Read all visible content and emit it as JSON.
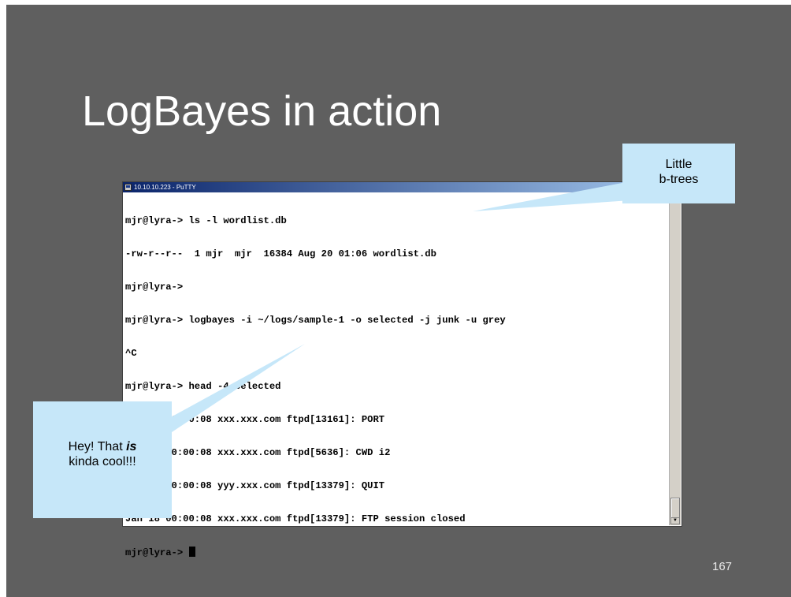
{
  "slide": {
    "title": "LogBayes in action",
    "page_number": "167"
  },
  "window": {
    "title": "10.10.10.223 - PuTTY",
    "icon": "putty-icon"
  },
  "terminal": {
    "lines": [
      "mjr@lyra-> ls -l wordlist.db",
      "-rw-r--r--  1 mjr  mjr  16384 Aug 20 01:06 wordlist.db",
      "mjr@lyra->",
      "mjr@lyra-> logbayes -i ~/logs/sample-1 -o selected -j junk -u grey",
      "^C",
      "mjr@lyra-> head -4 selected",
      "Jan 18 00:00:08 xxx.xxx.com ftpd[13161]: PORT",
      "Jan 18 00:00:08 xxx.xxx.com ftpd[5636]: CWD i2",
      "Jan 18 00:00:08 yyy.xxx.com ftpd[13379]: QUIT",
      "Jan 18 00:00:08 xxx.xxx.com ftpd[13379]: FTP session closed"
    ],
    "prompt": "mjr@lyra-> "
  },
  "callouts": {
    "top": {
      "line1": "Little",
      "line2": "b-trees"
    },
    "bottom": {
      "part1": "Hey! That ",
      "emphasis": "is",
      "line2": "kinda cool!!!"
    }
  },
  "colors": {
    "slide_background": "#5f5f5f",
    "callout_fill": "#c6e7f9",
    "titlebar_start": "#0a246a",
    "titlebar_end": "#a6caf0"
  }
}
